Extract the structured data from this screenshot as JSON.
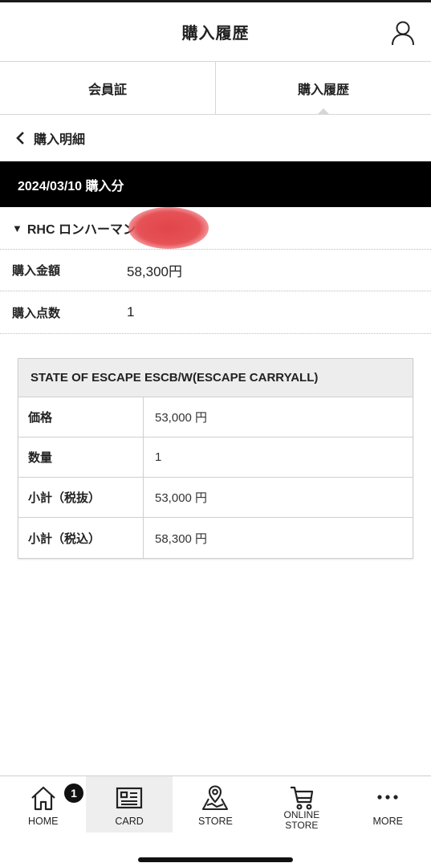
{
  "header": {
    "title": "購入履歴"
  },
  "tabs": [
    {
      "label": "会員証"
    },
    {
      "label": "購入履歴"
    }
  ],
  "back": {
    "label": "購入明細"
  },
  "purchase": {
    "date_label": "2024/03/10 購入分",
    "store_name": "RHC ロンハーマン",
    "amount_label": "購入金額",
    "amount_value": "58,300円",
    "count_label": "購入点数",
    "count_value": "1"
  },
  "item": {
    "name": "STATE OF ESCAPE ESCB/W(ESCAPE CARRYALL)",
    "rows": [
      {
        "key": "価格",
        "value": "53,000 円"
      },
      {
        "key": "数量",
        "value": "1"
      },
      {
        "key": "小計（税抜）",
        "value": "53,000 円"
      },
      {
        "key": "小計（税込）",
        "value": "58,300 円"
      }
    ]
  },
  "tabbar": {
    "items": [
      {
        "label": "HOME",
        "icon": "home-icon"
      },
      {
        "label": "CARD",
        "icon": "card-icon"
      },
      {
        "label": "STORE",
        "icon": "map-pin-icon"
      },
      {
        "label_line1": "ONLINE",
        "label_line2": "STORE",
        "icon": "cart-icon"
      },
      {
        "label": "MORE",
        "icon": "more-icon"
      }
    ],
    "home_badge": "1"
  }
}
